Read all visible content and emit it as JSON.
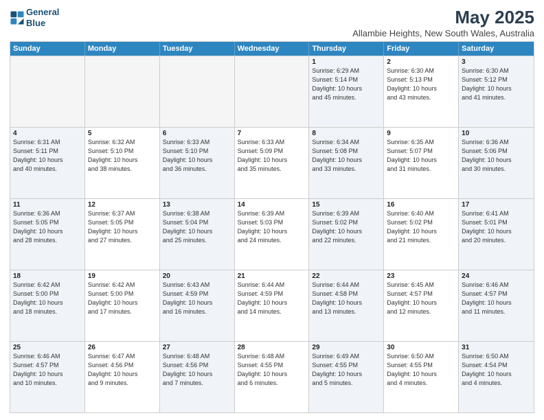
{
  "logo": {
    "line1": "General",
    "line2": "Blue"
  },
  "title": "May 2025",
  "location": "Allambie Heights, New South Wales, Australia",
  "weekdays": [
    "Sunday",
    "Monday",
    "Tuesday",
    "Wednesday",
    "Thursday",
    "Friday",
    "Saturday"
  ],
  "rows": [
    [
      {
        "day": "",
        "info": "",
        "empty": true
      },
      {
        "day": "",
        "info": "",
        "empty": true
      },
      {
        "day": "",
        "info": "",
        "empty": true
      },
      {
        "day": "",
        "info": "",
        "empty": true
      },
      {
        "day": "1",
        "info": "Sunrise: 6:29 AM\nSunset: 5:14 PM\nDaylight: 10 hours\nand 45 minutes."
      },
      {
        "day": "2",
        "info": "Sunrise: 6:30 AM\nSunset: 5:13 PM\nDaylight: 10 hours\nand 43 minutes."
      },
      {
        "day": "3",
        "info": "Sunrise: 6:30 AM\nSunset: 5:12 PM\nDaylight: 10 hours\nand 41 minutes."
      }
    ],
    [
      {
        "day": "4",
        "info": "Sunrise: 6:31 AM\nSunset: 5:11 PM\nDaylight: 10 hours\nand 40 minutes."
      },
      {
        "day": "5",
        "info": "Sunrise: 6:32 AM\nSunset: 5:10 PM\nDaylight: 10 hours\nand 38 minutes."
      },
      {
        "day": "6",
        "info": "Sunrise: 6:33 AM\nSunset: 5:10 PM\nDaylight: 10 hours\nand 36 minutes."
      },
      {
        "day": "7",
        "info": "Sunrise: 6:33 AM\nSunset: 5:09 PM\nDaylight: 10 hours\nand 35 minutes."
      },
      {
        "day": "8",
        "info": "Sunrise: 6:34 AM\nSunset: 5:08 PM\nDaylight: 10 hours\nand 33 minutes."
      },
      {
        "day": "9",
        "info": "Sunrise: 6:35 AM\nSunset: 5:07 PM\nDaylight: 10 hours\nand 31 minutes."
      },
      {
        "day": "10",
        "info": "Sunrise: 6:36 AM\nSunset: 5:06 PM\nDaylight: 10 hours\nand 30 minutes."
      }
    ],
    [
      {
        "day": "11",
        "info": "Sunrise: 6:36 AM\nSunset: 5:05 PM\nDaylight: 10 hours\nand 28 minutes."
      },
      {
        "day": "12",
        "info": "Sunrise: 6:37 AM\nSunset: 5:05 PM\nDaylight: 10 hours\nand 27 minutes."
      },
      {
        "day": "13",
        "info": "Sunrise: 6:38 AM\nSunset: 5:04 PM\nDaylight: 10 hours\nand 25 minutes."
      },
      {
        "day": "14",
        "info": "Sunrise: 6:39 AM\nSunset: 5:03 PM\nDaylight: 10 hours\nand 24 minutes."
      },
      {
        "day": "15",
        "info": "Sunrise: 6:39 AM\nSunset: 5:02 PM\nDaylight: 10 hours\nand 22 minutes."
      },
      {
        "day": "16",
        "info": "Sunrise: 6:40 AM\nSunset: 5:02 PM\nDaylight: 10 hours\nand 21 minutes."
      },
      {
        "day": "17",
        "info": "Sunrise: 6:41 AM\nSunset: 5:01 PM\nDaylight: 10 hours\nand 20 minutes."
      }
    ],
    [
      {
        "day": "18",
        "info": "Sunrise: 6:42 AM\nSunset: 5:00 PM\nDaylight: 10 hours\nand 18 minutes."
      },
      {
        "day": "19",
        "info": "Sunrise: 6:42 AM\nSunset: 5:00 PM\nDaylight: 10 hours\nand 17 minutes."
      },
      {
        "day": "20",
        "info": "Sunrise: 6:43 AM\nSunset: 4:59 PM\nDaylight: 10 hours\nand 16 minutes."
      },
      {
        "day": "21",
        "info": "Sunrise: 6:44 AM\nSunset: 4:59 PM\nDaylight: 10 hours\nand 14 minutes."
      },
      {
        "day": "22",
        "info": "Sunrise: 6:44 AM\nSunset: 4:58 PM\nDaylight: 10 hours\nand 13 minutes."
      },
      {
        "day": "23",
        "info": "Sunrise: 6:45 AM\nSunset: 4:57 PM\nDaylight: 10 hours\nand 12 minutes."
      },
      {
        "day": "24",
        "info": "Sunrise: 6:46 AM\nSunset: 4:57 PM\nDaylight: 10 hours\nand 11 minutes."
      }
    ],
    [
      {
        "day": "25",
        "info": "Sunrise: 6:46 AM\nSunset: 4:57 PM\nDaylight: 10 hours\nand 10 minutes."
      },
      {
        "day": "26",
        "info": "Sunrise: 6:47 AM\nSunset: 4:56 PM\nDaylight: 10 hours\nand 9 minutes."
      },
      {
        "day": "27",
        "info": "Sunrise: 6:48 AM\nSunset: 4:56 PM\nDaylight: 10 hours\nand 7 minutes."
      },
      {
        "day": "28",
        "info": "Sunrise: 6:48 AM\nSunset: 4:55 PM\nDaylight: 10 hours\nand 6 minutes."
      },
      {
        "day": "29",
        "info": "Sunrise: 6:49 AM\nSunset: 4:55 PM\nDaylight: 10 hours\nand 5 minutes."
      },
      {
        "day": "30",
        "info": "Sunrise: 6:50 AM\nSunset: 4:55 PM\nDaylight: 10 hours\nand 4 minutes."
      },
      {
        "day": "31",
        "info": "Sunrise: 6:50 AM\nSunset: 4:54 PM\nDaylight: 10 hours\nand 4 minutes."
      }
    ]
  ]
}
